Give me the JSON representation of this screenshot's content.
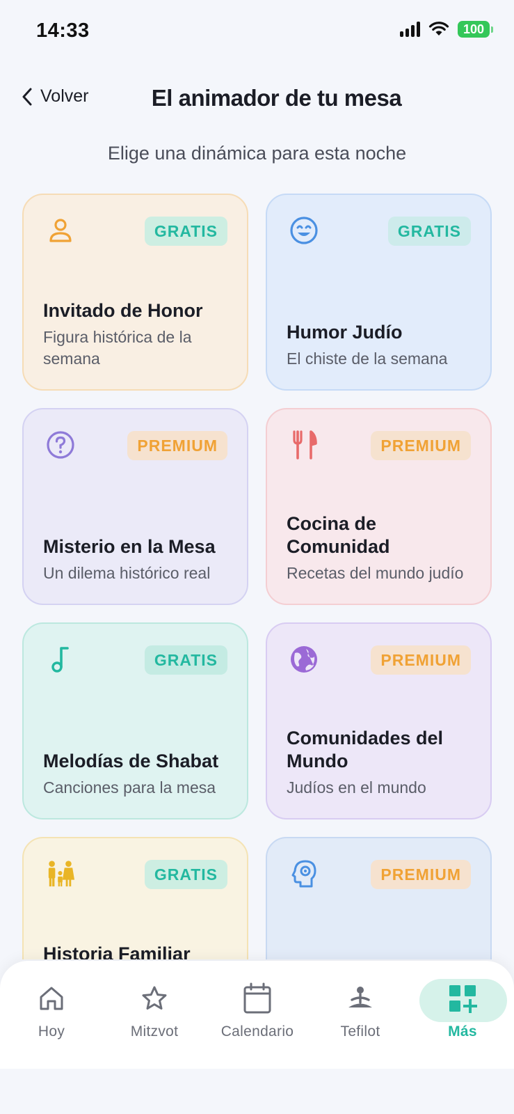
{
  "status": {
    "time": "14:33",
    "battery": "100"
  },
  "header": {
    "back_label": "Volver",
    "title": "El animador de tu mesa"
  },
  "subtitle": "Elige una dinámica para esta noche",
  "cards": [
    {
      "title": "Invitado de Honor",
      "desc": "Figura histórica de la semana",
      "badge": "GRATIS",
      "icon": "person-icon",
      "color": "#f0a235"
    },
    {
      "title": "Humor Judío",
      "desc": "El chiste de la semana",
      "badge": "GRATIS",
      "icon": "smiley-icon",
      "color": "#4a90e2"
    },
    {
      "title": "Misterio en la Mesa",
      "desc": "Un dilema histórico real",
      "badge": "PREMIUM",
      "icon": "question-icon",
      "color": "#8e7ad8"
    },
    {
      "title": "Cocina de Comunidad",
      "desc": "Recetas del mundo judío",
      "badge": "PREMIUM",
      "icon": "cutlery-icon",
      "color": "#e86a6a"
    },
    {
      "title": "Melodías de Shabat",
      "desc": "Canciones para la mesa",
      "badge": "GRATIS",
      "icon": "music-note-icon",
      "color": "#23b8a0"
    },
    {
      "title": "Comunidades del Mundo",
      "desc": "Judíos en el mundo",
      "badge": "PREMIUM",
      "icon": "globe-icon",
      "color": "#9b6ad6"
    },
    {
      "title": "Historia Familiar",
      "desc": "",
      "badge": "GRATIS",
      "icon": "family-icon",
      "color": "#e9b526"
    },
    {
      "title": "",
      "desc": "",
      "badge": "PREMIUM",
      "icon": "head-gear-icon",
      "color": "#4a90e2"
    }
  ],
  "nav": [
    {
      "label": "Hoy",
      "icon": "home-icon"
    },
    {
      "label": "Mitzvot",
      "icon": "star-icon"
    },
    {
      "label": "Calendario",
      "icon": "calendar-icon"
    },
    {
      "label": "Tefilot",
      "icon": "prayer-icon"
    },
    {
      "label": "Más",
      "icon": "grid-plus-icon",
      "active": true
    }
  ]
}
